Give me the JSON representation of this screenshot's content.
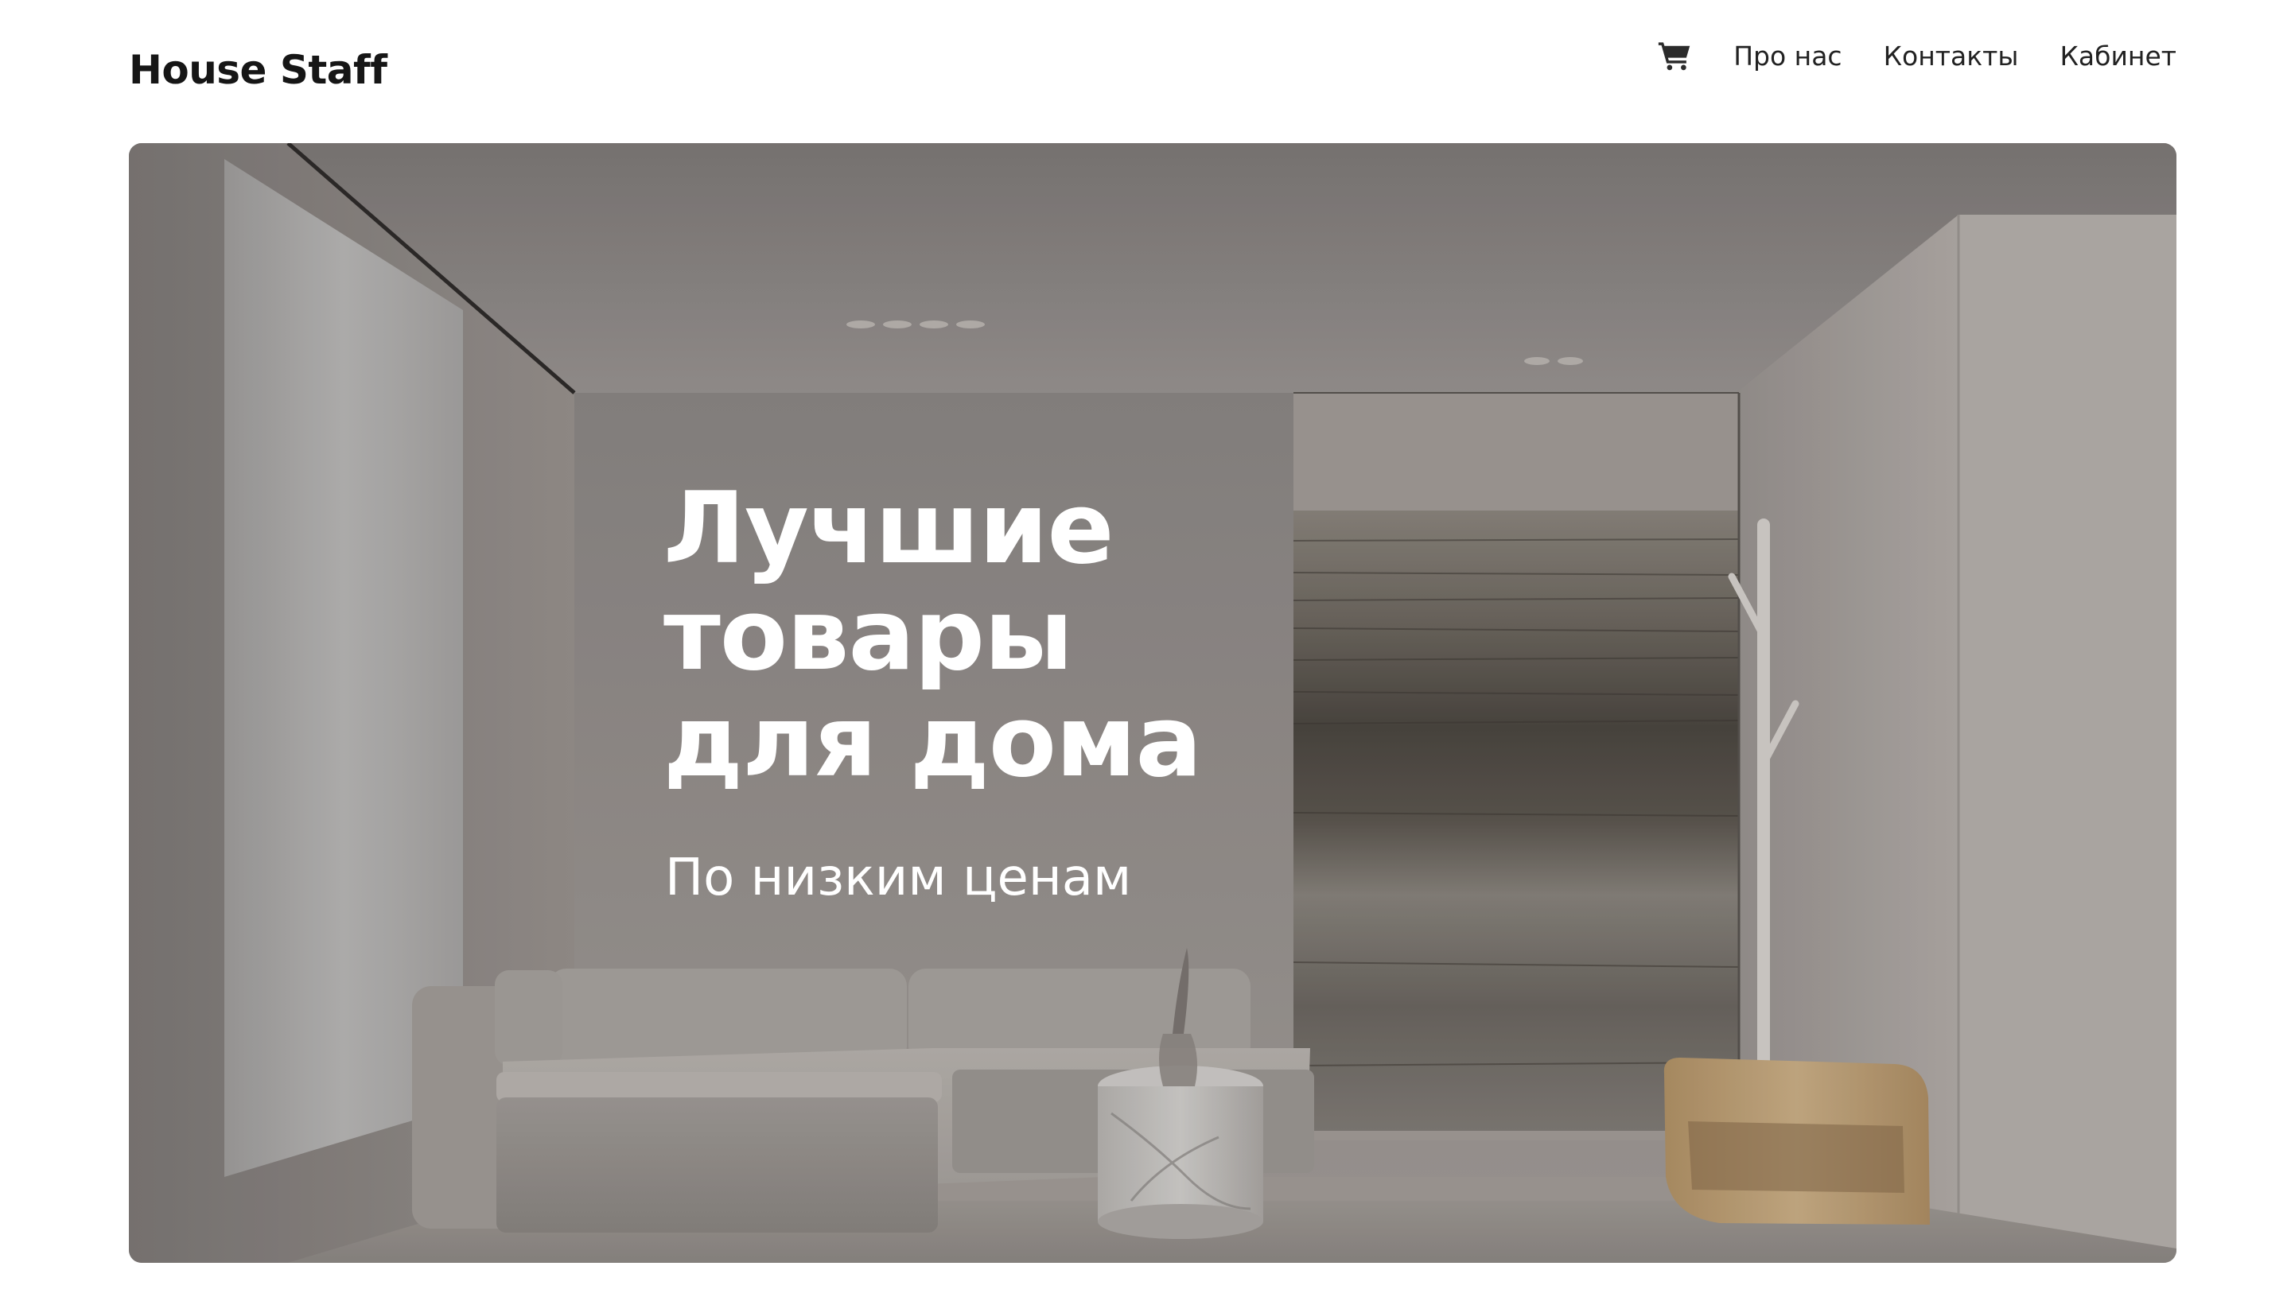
{
  "header": {
    "logo": "House Staff",
    "cart_icon": "cart-icon",
    "nav": [
      "Про нас",
      "Контакты",
      "Кабинет"
    ]
  },
  "hero": {
    "title": "Лучшие товары для дома",
    "subtitle": "По низким ценам",
    "image": "minimalist living room with sofa, side table, abstract painting and coat stand"
  },
  "colors": {
    "text_dark": "#1b1b1b",
    "hero_text": "#ffffff",
    "hero_wall": "#8c8785"
  }
}
